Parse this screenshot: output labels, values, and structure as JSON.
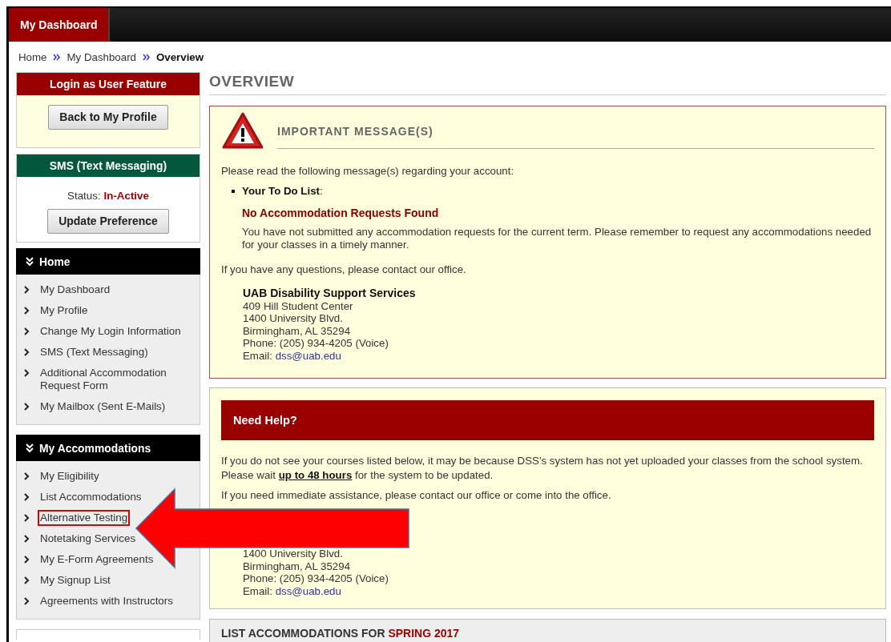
{
  "top_tabs": [
    {
      "label": "My Dashboard",
      "selected": true
    }
  ],
  "breadcrumb": [
    {
      "label": "Home",
      "current": false
    },
    {
      "label": "My Dashboard",
      "current": false
    },
    {
      "label": "Overview",
      "current": true
    }
  ],
  "sidebar": {
    "login_panel": {
      "title": "Login as User Feature",
      "button": "Back to My Profile"
    },
    "sms_panel": {
      "title": "SMS (Text Messaging)",
      "status_label": "Status:",
      "status": "In-Active",
      "button": "Update Preference"
    },
    "nav_sections": [
      {
        "title": "Home",
        "expanded": true,
        "items": [
          {
            "label": "My Dashboard",
            "highlighted": false
          },
          {
            "label": "My Profile",
            "highlighted": false
          },
          {
            "label": "Change My Login Information",
            "highlighted": false
          },
          {
            "label": "SMS (Text Messaging)",
            "highlighted": false
          },
          {
            "label": "Additional Accommodation Request Form",
            "highlighted": false
          },
          {
            "label": "My Mailbox (Sent E-Mails)",
            "highlighted": false
          }
        ]
      },
      {
        "title": "My Accommodations",
        "expanded": true,
        "items": [
          {
            "label": "My Eligibility",
            "highlighted": false
          },
          {
            "label": "List Accommodations",
            "highlighted": false
          },
          {
            "label": "Alternative Testing",
            "highlighted": true
          },
          {
            "label": "Notetaking Services",
            "highlighted": false
          },
          {
            "label": "My E-Form Agreements",
            "highlighted": false
          },
          {
            "label": "My Signup List",
            "highlighted": false
          },
          {
            "label": "Agreements with Instructors",
            "highlighted": false
          }
        ]
      }
    ]
  },
  "main": {
    "title": "OVERVIEW",
    "important": {
      "heading": "IMPORTANT MESSAGE(S)",
      "intro": "Please read the following message(s) regarding your account:",
      "todo": [
        {
          "title": "**Your To Do List**:",
          "status": "No Accommodation Requests Found",
          "text": "You have not submitted any accommodation requests for the current term. Please remember to request any accommodations needed for your classes in a timely manner."
        }
      ],
      "questions": "If you have any questions, please contact our office.",
      "contact": {
        "name": "UAB Disability Support Services",
        "lines": [
          "409 Hill Student Center",
          "1400 University Blvd.",
          "Birmingham, AL 35294",
          "Phone: (205) 934-4205 (Voice)"
        ],
        "email_label": "Email:",
        "email": "dss@uab.edu"
      }
    },
    "help": {
      "title": "Need Help?",
      "paragraphs": [
        "If you do not see your courses listed below, it may be because DSS's system has not yet uploaded your classes from the school system.",
        "Please wait **up to 48 hours** for the system to be updated."
      ],
      "assistance": "If you need immediate assistance, please contact our office or come into the office.",
      "contact": {
        "lines": [
          "1400 University Blvd.",
          "Birmingham, AL 35294",
          "Phone: (205) 934-4205 (Voice)"
        ],
        "email_label": "Email:",
        "email": "dss@uab.edu"
      }
    },
    "list_header": {
      "text": "LIST ACCOMMODATIONS FOR",
      "term": "SPRING 2017"
    }
  }
}
